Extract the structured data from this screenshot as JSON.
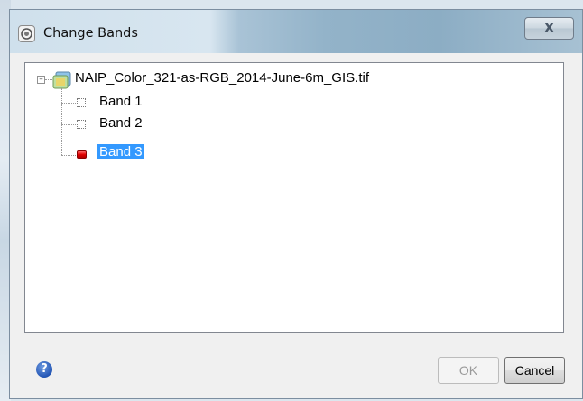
{
  "window": {
    "title": "Change Bands",
    "close_label": "X"
  },
  "tree": {
    "root": {
      "label": "NAIP_Color_321-as-RGB_2014-June-6m_GIS.tif",
      "expanded": true
    },
    "bands": [
      {
        "label": "Band 1",
        "state": "empty"
      },
      {
        "label": "Band 2",
        "state": "empty"
      },
      {
        "label": "Band 3",
        "state": "red",
        "selected": true
      }
    ]
  },
  "footer": {
    "help_glyph": "?",
    "ok_label": "OK",
    "ok_enabled": false,
    "cancel_label": "Cancel"
  },
  "colors": {
    "selection": "#3399ff",
    "band_marker_active": "#e00000"
  }
}
